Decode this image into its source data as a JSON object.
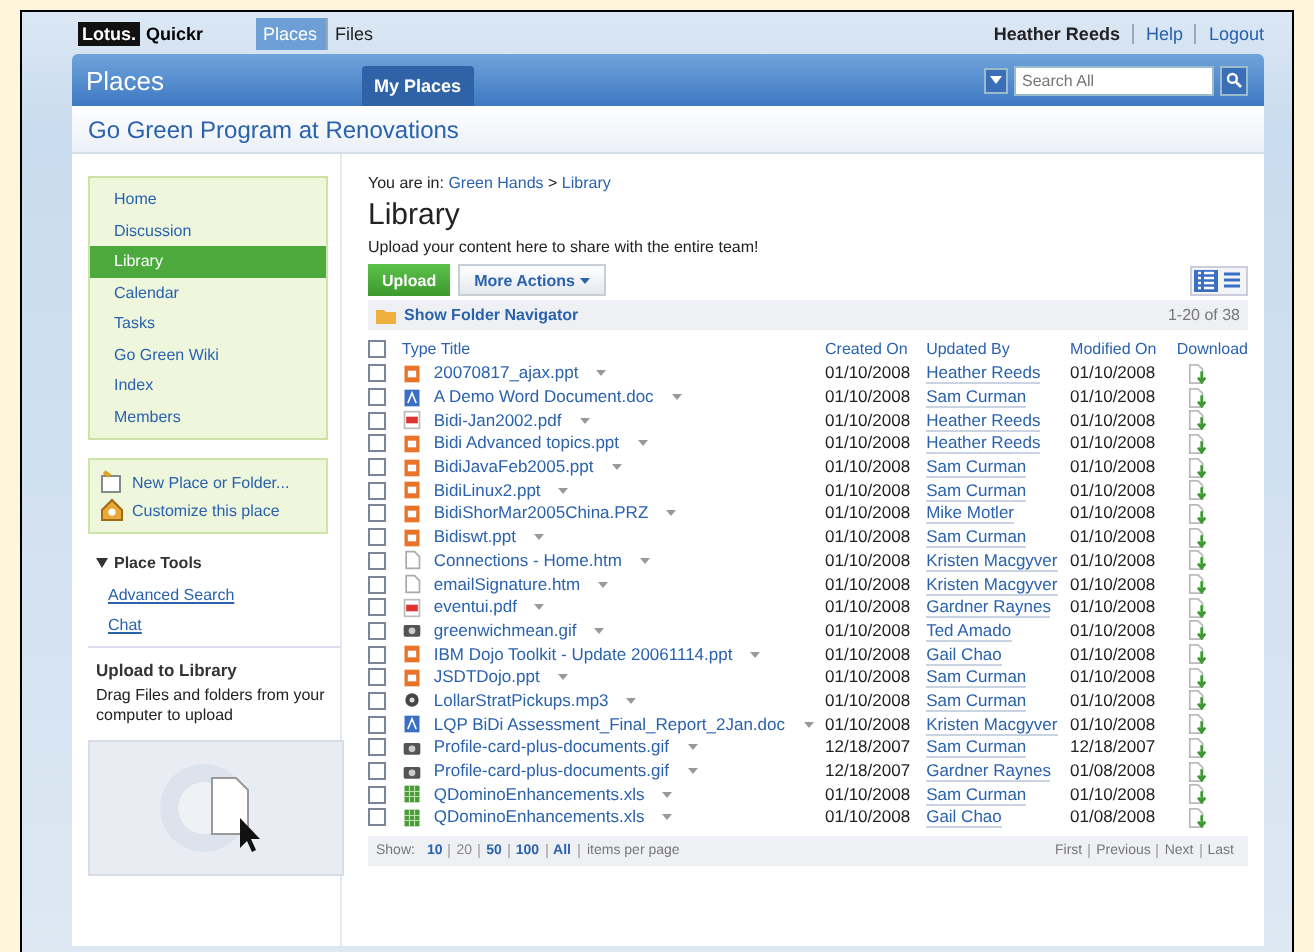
{
  "top_bar": {
    "logo_badge": "Lotus.",
    "logo_text": "Quickr",
    "nav": [
      {
        "label": "Places",
        "selected": true
      },
      {
        "label": "Files",
        "selected": false
      }
    ],
    "user": "Heather Reeds",
    "links": [
      "Help",
      "Logout"
    ]
  },
  "header": {
    "title": "Places",
    "tab": "My Places",
    "search": {
      "placeholder": "Search All"
    }
  },
  "place_title": "Go Green Program at Renovations",
  "sidebar": {
    "items": [
      {
        "label": "Home",
        "selected": false
      },
      {
        "label": "Discussion",
        "selected": false
      },
      {
        "label": "Library",
        "selected": true
      },
      {
        "label": "Calendar",
        "selected": false
      },
      {
        "label": "Tasks",
        "selected": false
      },
      {
        "label": "Go Green Wiki",
        "selected": false
      },
      {
        "label": "Index",
        "selected": false
      },
      {
        "label": "Members",
        "selected": false
      }
    ],
    "actions": [
      {
        "label": "New Place or Folder...",
        "kind": "folder"
      },
      {
        "label": "Customize this place",
        "kind": "customize"
      }
    ],
    "tools": {
      "title": "Place Tools",
      "expanded": true,
      "links": [
        "Advanced Search",
        "Chat"
      ]
    },
    "upload": {
      "title": "Upload to Library",
      "text": "Drag Files and folders from your computer to upload"
    }
  },
  "breadcrumb": {
    "prefix": "You are in:",
    "links": [
      "Green Hands",
      "Library"
    ],
    "separator": ">"
  },
  "library": {
    "title": "Library",
    "description": "Upload your content here to share with the entire team!",
    "buttons": [
      "Upload",
      "More Actions"
    ],
    "views": [
      {
        "kind": "details",
        "selected": true
      },
      {
        "kind": "list",
        "selected": false
      }
    ],
    "folder_navigator": "Show Folder Navigator",
    "count": "1-20 of 38",
    "select_all_checked": false,
    "columns": [
      "Type",
      "Title",
      "Created On",
      "Updated By",
      "Modified On",
      "Download"
    ],
    "rows": [
      {
        "kind": "ppt",
        "title": "20070817_ajax.ppt",
        "created": "01/10/2008",
        "updated_by": "Heather Reeds",
        "modified": "01/10/2008",
        "checked": false
      },
      {
        "kind": "doc",
        "title": "A Demo Word Document.doc",
        "created": "01/10/2008",
        "updated_by": "Sam Curman",
        "modified": "01/10/2008",
        "checked": false
      },
      {
        "kind": "pdf",
        "title": "Bidi-Jan2002.pdf",
        "created": "01/10/2008",
        "updated_by": "Heather Reeds",
        "modified": "01/10/2008",
        "checked": false
      },
      {
        "kind": "ppt",
        "title": "Bidi Advanced topics.ppt",
        "created": "01/10/2008",
        "updated_by": "Heather Reeds",
        "modified": "01/10/2008",
        "checked": false
      },
      {
        "kind": "ppt",
        "title": "BidiJavaFeb2005.ppt",
        "created": "01/10/2008",
        "updated_by": "Sam Curman",
        "modified": "01/10/2008",
        "checked": false
      },
      {
        "kind": "ppt",
        "title": "BidiLinux2.ppt",
        "created": "01/10/2008",
        "updated_by": "Sam Curman",
        "modified": "01/10/2008",
        "checked": false
      },
      {
        "kind": "ppt",
        "title": "BidiShorMar2005China.PRZ",
        "created": "01/10/2008",
        "updated_by": "Mike Motler",
        "modified": "01/10/2008",
        "checked": false
      },
      {
        "kind": "ppt",
        "title": "Bidiswt.ppt",
        "created": "01/10/2008",
        "updated_by": "Sam Curman",
        "modified": "01/10/2008",
        "checked": false
      },
      {
        "kind": "htm",
        "title": "Connections - Home.htm",
        "created": "01/10/2008",
        "updated_by": "Kristen Macgyver",
        "modified": "01/10/2008",
        "checked": false
      },
      {
        "kind": "htm",
        "title": "emailSignature.htm",
        "created": "01/10/2008",
        "updated_by": "Kristen Macgyver",
        "modified": "01/10/2008",
        "checked": false
      },
      {
        "kind": "pdf",
        "title": "eventui.pdf",
        "created": "01/10/2008",
        "updated_by": "Gardner Raynes",
        "modified": "01/10/2008",
        "checked": false
      },
      {
        "kind": "gif",
        "title": "greenwichmean.gif",
        "created": "01/10/2008",
        "updated_by": "Ted Amado",
        "modified": "01/10/2008",
        "checked": false
      },
      {
        "kind": "ppt",
        "title": "IBM Dojo Toolkit - Update 20061114.ppt",
        "created": "01/10/2008",
        "updated_by": "Gail Chao",
        "modified": "01/10/2008",
        "checked": false
      },
      {
        "kind": "ppt",
        "title": "JSDTDojo.ppt",
        "created": "01/10/2008",
        "updated_by": "Sam Curman",
        "modified": "01/10/2008",
        "checked": false
      },
      {
        "kind": "mp3",
        "title": "LollarStratPickups.mp3",
        "created": "01/10/2008",
        "updated_by": "Sam Curman",
        "modified": "01/10/2008",
        "checked": false
      },
      {
        "kind": "doc",
        "title": "LQP BiDi Assessment_Final_Report_2Jan.doc",
        "created": "01/10/2008",
        "updated_by": "Kristen Macgyver",
        "modified": "01/10/2008",
        "checked": false
      },
      {
        "kind": "gif",
        "title": "Profile-card-plus-documents.gif",
        "created": "12/18/2007",
        "updated_by": "Sam Curman",
        "modified": "12/18/2007",
        "checked": false
      },
      {
        "kind": "gif",
        "title": "Profile-card-plus-documents.gif",
        "created": "12/18/2007",
        "updated_by": "Gardner Raynes",
        "modified": "01/08/2008",
        "checked": false
      },
      {
        "kind": "xls",
        "title": "QDominoEnhancements.xls",
        "created": "01/10/2008",
        "updated_by": "Sam Curman",
        "modified": "01/10/2008",
        "checked": false
      },
      {
        "kind": "xls",
        "title": "QDominoEnhancements.xls",
        "created": "01/10/2008",
        "updated_by": "Gail Chao",
        "modified": "01/08/2008",
        "checked": false
      }
    ],
    "pager": {
      "show_label": "Show:",
      "sizes": [
        {
          "label": "10",
          "selected": false
        },
        {
          "label": "20",
          "selected": true
        },
        {
          "label": "50",
          "selected": false
        },
        {
          "label": "100",
          "selected": false
        },
        {
          "label": "All",
          "selected": false
        }
      ],
      "suffix": "items per page",
      "nav": [
        "First",
        "Previous",
        "Next",
        "Last"
      ]
    }
  }
}
